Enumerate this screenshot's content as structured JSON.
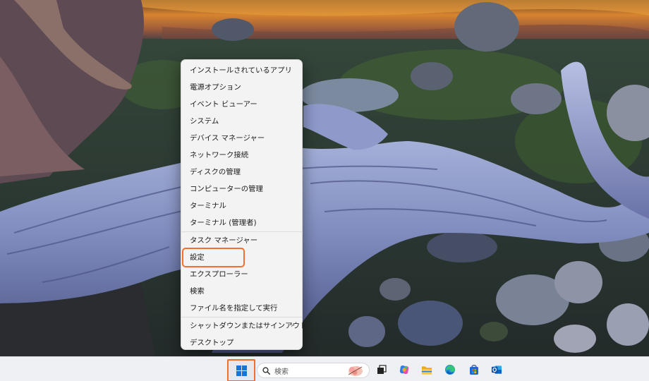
{
  "context_menu": {
    "items": [
      {
        "label": "インストールされているアプリ"
      },
      {
        "label": "電源オプション"
      },
      {
        "label": "イベント ビューアー"
      },
      {
        "label": "システム"
      },
      {
        "label": "デバイス マネージャー"
      },
      {
        "label": "ネットワーク接続"
      },
      {
        "label": "ディスクの管理"
      },
      {
        "label": "コンピューターの管理"
      },
      {
        "label": "ターミナル"
      },
      {
        "label": "ターミナル (管理者)"
      },
      {
        "label": "タスク マネージャー"
      },
      {
        "label": "設定"
      },
      {
        "label": "エクスプローラー"
      },
      {
        "label": "検索"
      },
      {
        "label": "ファイル名を指定して実行"
      },
      {
        "label": "シャットダウンまたはサインアウト",
        "chevron": "›"
      },
      {
        "label": "デスクトップ"
      }
    ]
  },
  "taskbar": {
    "search_placeholder": "検索",
    "icons": [
      "windows-start-icon",
      "search-icon",
      "task-view-icon",
      "copilot-icon",
      "file-explorer-icon",
      "edge-icon",
      "store-icon",
      "outlook-icon"
    ]
  },
  "colors": {
    "highlight": "#f07030",
    "windows_blue": "#1a73d9",
    "menu_bg": "#f3f3f3",
    "taskbar_bg": "#eef0f4"
  }
}
